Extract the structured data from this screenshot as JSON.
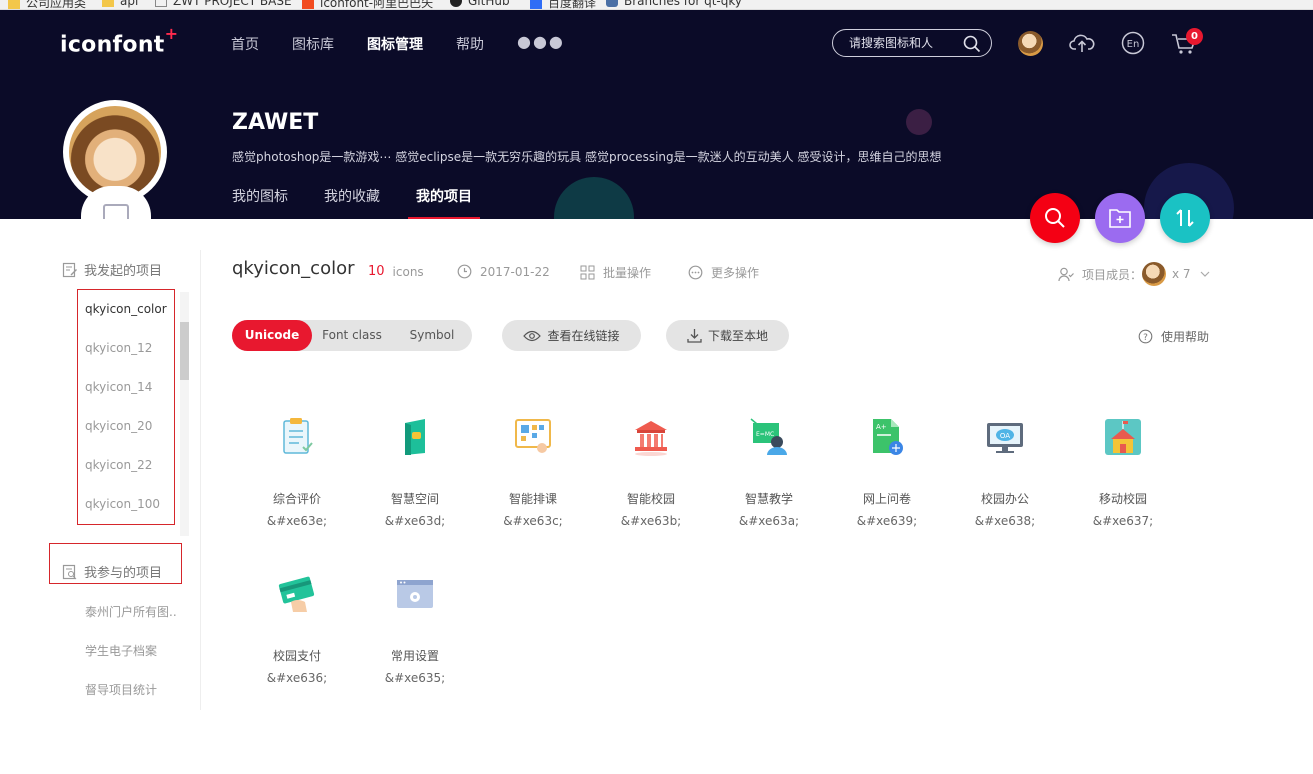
{
  "bookmarks": [
    {
      "label": "公司应用类"
    },
    {
      "label": "api"
    },
    {
      "label": "ZWT PROJECT BASE"
    },
    {
      "label": "iconfont-阿里巴巴矢"
    },
    {
      "label": "GitHub"
    },
    {
      "label": "百度翻译"
    },
    {
      "label": "Branches for qt-qky"
    }
  ],
  "header": {
    "logo": "iconfont",
    "nav": [
      "首页",
      "图标库",
      "图标管理",
      "帮助"
    ],
    "active_nav": "图标管理",
    "search_placeholder": "请搜索图标和人",
    "cart_count": "0"
  },
  "profile": {
    "name": "ZAWET",
    "bio": "感觉photoshop是一款游戏⋯ 感觉eclipse是一款无穷乐趣的玩具 感觉processing是一款迷人的互动美人 感受设计，思维自己的思想",
    "tabs": [
      "我的图标",
      "我的收藏",
      "我的项目"
    ],
    "active_tab": "我的项目"
  },
  "sidebar": {
    "started_title": "我发起的项目",
    "started": [
      "qkyicon_color",
      "qkyicon_12",
      "qkyicon_14",
      "qkyicon_20",
      "qkyicon_22",
      "qkyicon_100"
    ],
    "joined_title": "我参与的项目",
    "joined": [
      "泰州门户所有图..",
      "学生电子档案",
      "督导项目统计"
    ]
  },
  "project": {
    "name": "qkyicon_color",
    "count": "10",
    "count_unit": "icons",
    "date": "2017-01-22",
    "batch": "批量操作",
    "more": "更多操作",
    "members_label": "项目成员：",
    "members_count": "x 7",
    "modes": [
      "Unicode",
      "Font class",
      "Symbol"
    ],
    "active_mode": "Unicode",
    "view_link": "查看在线链接",
    "download": "下载至本地",
    "help": "使用帮助"
  },
  "icons": [
    {
      "name": "综合评价",
      "code": "&#xe63e;"
    },
    {
      "name": "智慧空间",
      "code": "&#xe63d;"
    },
    {
      "name": "智能排课",
      "code": "&#xe63c;"
    },
    {
      "name": "智能校园",
      "code": "&#xe63b;"
    },
    {
      "name": "智慧教学",
      "code": "&#xe63a;"
    },
    {
      "name": "网上问卷",
      "code": "&#xe639;"
    },
    {
      "name": "校园办公",
      "code": "&#xe638;"
    },
    {
      "name": "移动校园",
      "code": "&#xe637;"
    },
    {
      "name": "校园支付",
      "code": "&#xe636;"
    },
    {
      "name": "常用设置",
      "code": "&#xe635;"
    }
  ],
  "colors": {
    "header_bg": "#0b0b28",
    "accent_red": "#e8182f",
    "fab_search": "#f40014",
    "fab_add": "#9b6bf0",
    "fab_sort": "#1ac2c4"
  }
}
